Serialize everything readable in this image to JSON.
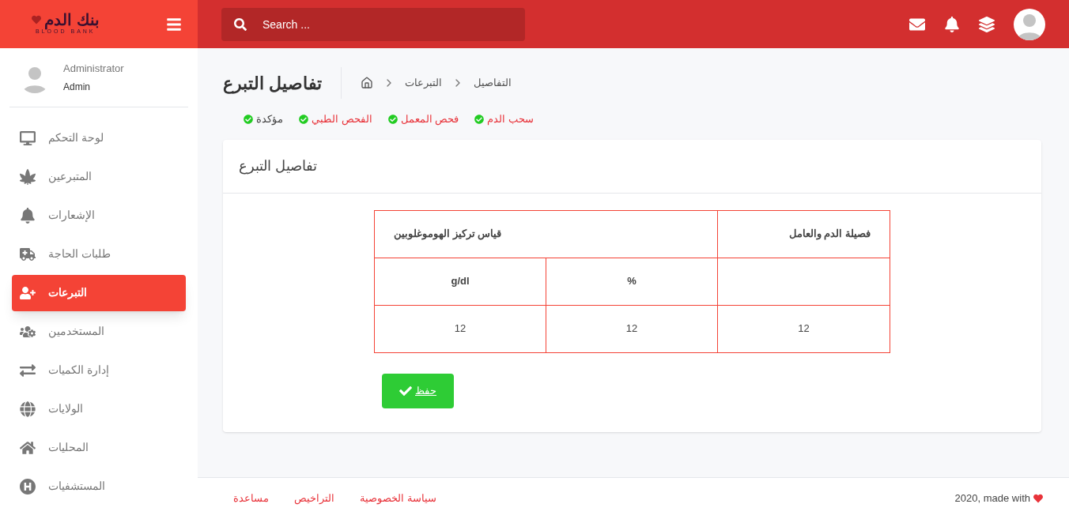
{
  "logo": {
    "title": "بنك الدم",
    "subtitle": "BLOOD BANK"
  },
  "search": {
    "placeholder": "Search ..."
  },
  "user": {
    "name": "Administrator",
    "role": "Admin"
  },
  "sidebar": {
    "items": [
      {
        "label": "لوحة التحكم",
        "selected": false
      },
      {
        "label": "المتبرعين",
        "selected": false
      },
      {
        "label": "الإشعارات",
        "selected": false
      },
      {
        "label": "طلبات الحاجة",
        "selected": false
      },
      {
        "label": "التبرعات",
        "selected": true
      },
      {
        "label": "المستخدمين",
        "selected": false
      },
      {
        "label": "إدارة الكميات",
        "selected": false
      },
      {
        "label": "الولايات",
        "selected": false
      },
      {
        "label": "المحليات",
        "selected": false
      },
      {
        "label": "المستشفيات",
        "selected": false
      }
    ]
  },
  "page": {
    "title": "تفاصيل التبرع",
    "breadcrumb": [
      "التفاصيل",
      "التبرعات"
    ]
  },
  "steps": [
    {
      "label": "سحب الدم",
      "done": true,
      "color": "#e8333a"
    },
    {
      "label": "فحص المعمل",
      "done": true,
      "color": "#e8333a"
    },
    {
      "label": "الفحص الطبي",
      "done": true,
      "color": "#e8333a"
    },
    {
      "label": "مؤكدة",
      "done": true,
      "color": "#444444"
    }
  ],
  "card": {
    "title": "تفاصيل التبرع",
    "table": {
      "header": {
        "first": "فصيلة الدم والعامل",
        "group": "قياس تركيز الهوموغلوبين",
        "sub": [
          "%",
          "g/dl"
        ]
      },
      "rows": [
        [
          "12",
          "12",
          "12"
        ]
      ]
    },
    "button": "حفظ"
  },
  "footer": {
    "credit": "2020, made with",
    "links": [
      "سياسة الخصوصية",
      "التراخيص",
      "مساعدة"
    ]
  }
}
